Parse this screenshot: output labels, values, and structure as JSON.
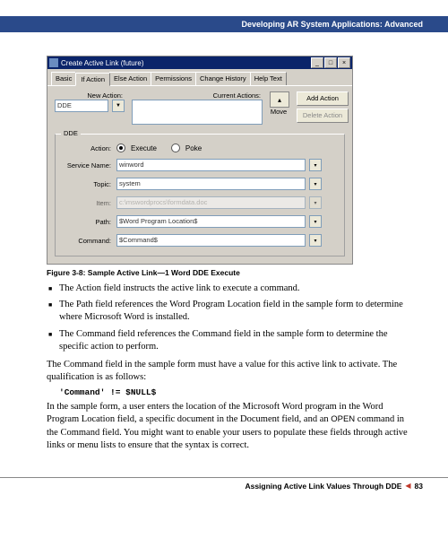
{
  "header": {
    "title": "Developing AR System Applications: Advanced"
  },
  "window": {
    "title": "Create Active Link (future)",
    "tabs": [
      "Basic",
      "If Action",
      "Else Action",
      "Permissions",
      "Change History",
      "Help Text"
    ],
    "new_action_label": "New Action:",
    "new_action_value": "DDE",
    "current_actions_label": "Current Actions:",
    "move_label": "Move",
    "add_action": "Add Action",
    "delete_action": "Delete Action",
    "dde_label": "DDE",
    "fields": {
      "action_label": "Action:",
      "action_execute": "Execute",
      "action_poke": "Poke",
      "service_label": "Service Name:",
      "service_value": "winword",
      "topic_label": "Topic:",
      "topic_value": "system",
      "item_label": "Item:",
      "item_value": "",
      "path_label": "Path:",
      "path_value": "$Word Program Location$",
      "command_label": "Command:",
      "command_value": "$Command$",
      "ref_value": "c:\\mswordprocs\\formdata.doc"
    }
  },
  "caption": "Figure 3-8:  Sample Active Link—1 Word DDE Execute",
  "bullets": [
    "The Action field instructs the active link to execute a command.",
    "The Path field references the Word Program Location field in the sample form to determine where Microsoft Word is installed.",
    "The Command field references the Command field in the sample form to determine the specific action to perform."
  ],
  "para1": "The Command field in the sample form must have a value for this active link to activate. The qualification is as follows:",
  "qual": "'Command' != $NULL$",
  "para2_a": "In the sample form, a user enters the location of the Microsoft Word program in the Word Program Location field, a specific document in the Document field, and an ",
  "para2_open": "OPEN",
  "para2_b": " command in the Command field. You might want to enable your users to populate these fields through active links or menu lists to ensure that the syntax is correct.",
  "footer": {
    "section": "Assigning Active Link Values Through DDE",
    "page": "83"
  }
}
